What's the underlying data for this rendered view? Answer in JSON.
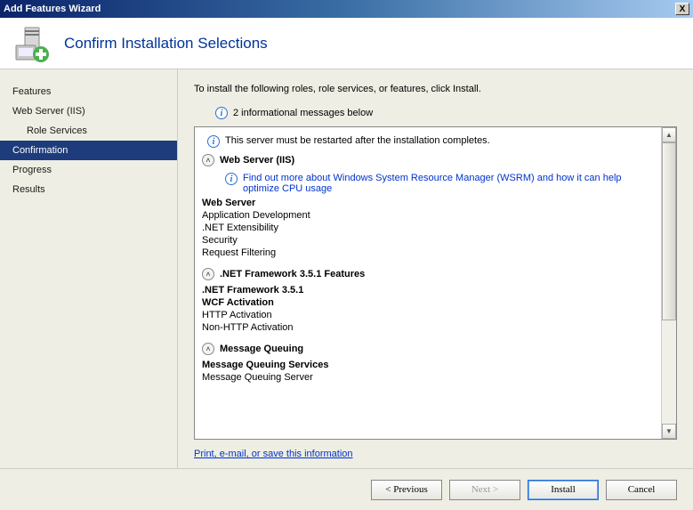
{
  "window": {
    "title": "Add Features Wizard",
    "close": "X"
  },
  "header": {
    "title": "Confirm Installation Selections"
  },
  "sidebar": {
    "items": [
      {
        "label": "Features",
        "sub": false,
        "active": false
      },
      {
        "label": "Web Server (IIS)",
        "sub": false,
        "active": false
      },
      {
        "label": "Role Services",
        "sub": true,
        "active": false
      },
      {
        "label": "Confirmation",
        "sub": false,
        "active": true
      },
      {
        "label": "Progress",
        "sub": false,
        "active": false
      },
      {
        "label": "Results",
        "sub": false,
        "active": false
      }
    ]
  },
  "main": {
    "intro": "To install the following roles, role services, or features, click Install.",
    "info_count": "2 informational messages below",
    "restart_msg": "This server must be restarted after the installation completes.",
    "wsrm_link": "Find out more about Windows System Resource Manager (WSRM) and how it can help optimize CPU usage",
    "sections": {
      "iis": {
        "title": "Web Server (IIS)",
        "web_server": "Web Server",
        "app_dev": "Application Development",
        "net_ext": ".NET Extensibility",
        "security": "Security",
        "req_filter": "Request Filtering"
      },
      "netfx": {
        "title": ".NET Framework 3.5.1 Features",
        "net351": ".NET Framework 3.5.1",
        "wcf": "WCF Activation",
        "http": "HTTP Activation",
        "nonhttp": "Non-HTTP Activation"
      },
      "msmq": {
        "title": "Message Queuing",
        "services": "Message Queuing Services",
        "server": "Message Queuing Server"
      }
    },
    "save_link": "Print, e-mail, or save this information"
  },
  "footer": {
    "previous": "< Previous",
    "next": "Next >",
    "install": "Install",
    "cancel": "Cancel"
  }
}
